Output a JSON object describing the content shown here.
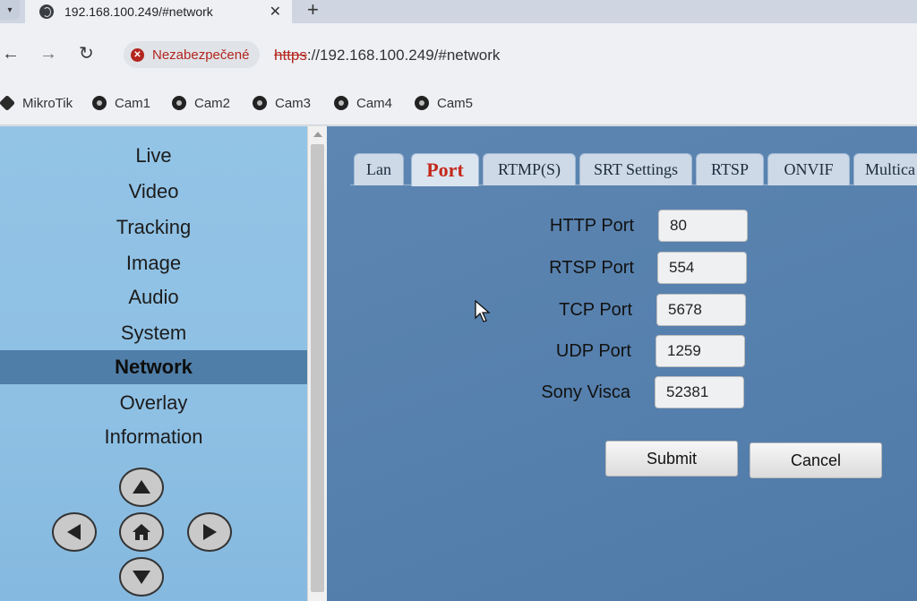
{
  "browser": {
    "tab_title": "192.168.100.249/#network",
    "security_label": "Nezabezpečené",
    "url_scheme": "https",
    "url_rest": "://192.168.100.249/#network",
    "bookmarks": [
      "MikroTik",
      "Cam1",
      "Cam2",
      "Cam3",
      "Cam4",
      "Cam5"
    ]
  },
  "menu": {
    "items": [
      "Live",
      "Video",
      "Tracking",
      "Image",
      "Audio",
      "System",
      "Network",
      "Overlay",
      "Information"
    ],
    "active": "Network"
  },
  "tabs": {
    "items": [
      "Lan",
      "Port",
      "RTMP(S)",
      "SRT Settings",
      "RTSP",
      "ONVIF",
      "Multica"
    ],
    "active": "Port"
  },
  "form": {
    "fields": [
      {
        "label": "HTTP Port",
        "value": "80"
      },
      {
        "label": "RTSP Port",
        "value": "554"
      },
      {
        "label": "TCP Port",
        "value": "5678"
      },
      {
        "label": "UDP Port",
        "value": "1259"
      },
      {
        "label": "Sony Visca",
        "value": "52381"
      }
    ],
    "submit_label": "Submit",
    "cancel_label": "Cancel"
  },
  "colors": {
    "accent_active_tab": "#c4281b",
    "menu_active_bg": "#4f7ea8",
    "insecure_red": "#b3261e"
  }
}
